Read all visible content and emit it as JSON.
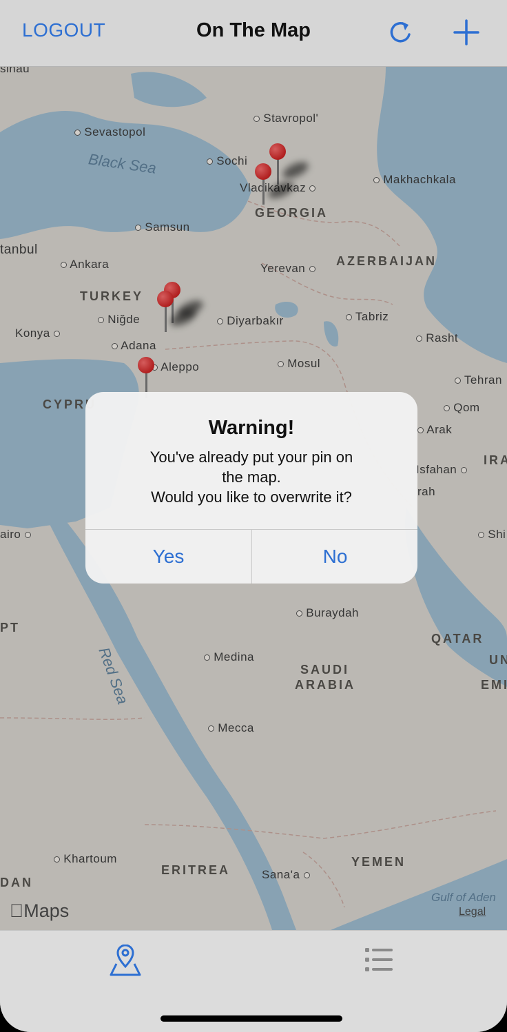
{
  "navbar": {
    "logout_label": "LOGOUT",
    "title": "On The Map",
    "refresh_icon": "refresh-icon",
    "add_icon": "plus-icon",
    "accent_color": "#2d6fd2"
  },
  "map": {
    "sea_labels": [
      "Black Sea",
      "Red Sea",
      "Gulf of Aden"
    ],
    "cities": [
      "sinau",
      "Sevastopol",
      "Stavropol'",
      "Sochi",
      "Vladikavkaz",
      "Makhachkala",
      "Samsun",
      "tanbul",
      "Ankara",
      "Yerevan",
      "Niğde",
      "Konya",
      "Diyarbakır",
      "Tabriz",
      "Rasht",
      "Adana",
      "Aleppo",
      "Mosul",
      "Tehran",
      "Qom",
      "Arak",
      "Isfahan",
      "rah",
      "airo",
      "Shi",
      "Buraydah",
      "Medina",
      "Mecca",
      "Khartoum",
      "Sana'a"
    ],
    "countries": [
      "GEORGIA",
      "AZERBAIJAN",
      "TURKEY",
      "CYPRU",
      "PT",
      "SAUDI",
      "ARABIA",
      "QATAR",
      "ERITREA",
      "YEMEN",
      "DAN",
      "IRA",
      "UN",
      "EMI"
    ],
    "attribution": "Maps",
    "legal_label": "Legal"
  },
  "alert": {
    "title": "Warning!",
    "message_line1": "You've already put your pin on",
    "message_line2": "the map.",
    "message_line3": "Would you like to overwrite it?",
    "yes_label": "Yes",
    "no_label": "No"
  },
  "tabbar": {
    "tabs": [
      {
        "icon": "map-pin-icon",
        "selected": true
      },
      {
        "icon": "list-icon",
        "selected": false
      }
    ]
  }
}
